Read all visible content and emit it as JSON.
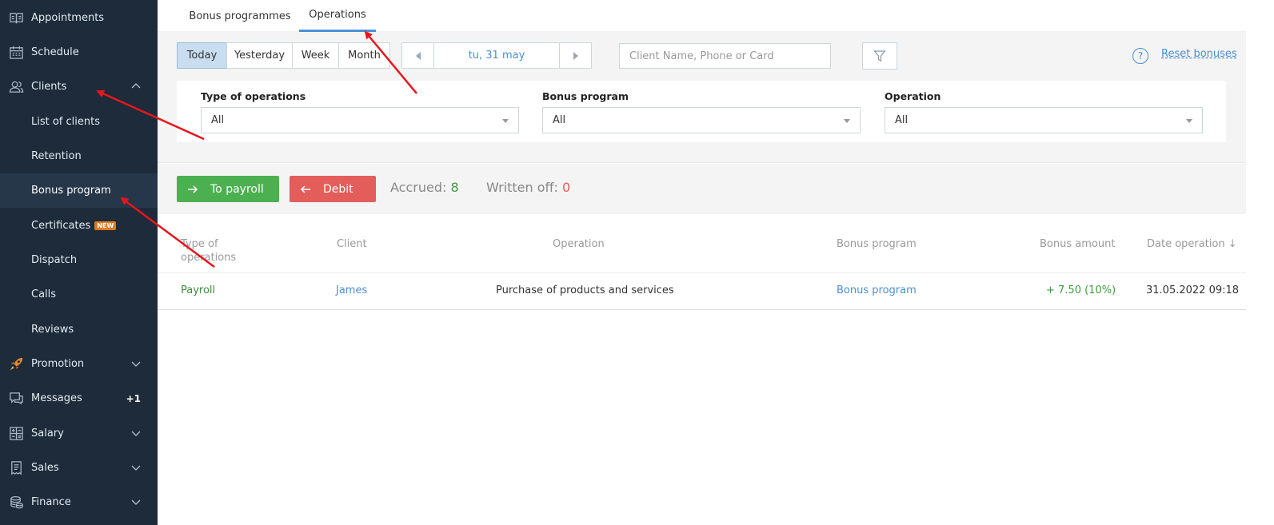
{
  "sidebar": {
    "items": [
      {
        "label": "Appointments",
        "icon": "book-icon"
      },
      {
        "label": "Schedule",
        "icon": "calendar-icon"
      },
      {
        "label": "Clients",
        "icon": "users-icon"
      },
      {
        "label": "List of clients"
      },
      {
        "label": "Retention"
      },
      {
        "label": "Bonus program"
      },
      {
        "label": "Certificates",
        "badge": "NEW"
      },
      {
        "label": "Dispatch"
      },
      {
        "label": "Calls"
      },
      {
        "label": "Reviews"
      },
      {
        "label": "Promotion",
        "icon": "rocket-icon"
      },
      {
        "label": "Messages",
        "icon": "messages-icon",
        "count": "+1"
      },
      {
        "label": "Salary",
        "icon": "calculator-icon"
      },
      {
        "label": "Sales",
        "icon": "receipt-icon"
      },
      {
        "label": "Finance",
        "icon": "coins-icon"
      }
    ]
  },
  "tabs": [
    "Bonus programmes",
    "Operations"
  ],
  "period": [
    "Today",
    "Yesterday",
    "Week",
    "Month"
  ],
  "date_label": "tu, 31 may",
  "search": {
    "placeholder": "Client Name, Phone or Card"
  },
  "help_glyph": "?",
  "reset_bonuses": "Reset bonuses",
  "filters": [
    {
      "label": "Type of operations",
      "value": "All"
    },
    {
      "label": "Bonus program",
      "value": "All"
    },
    {
      "label": "Operation",
      "value": "All"
    }
  ],
  "actions": {
    "to_payroll": "To payroll",
    "debit": "Debit"
  },
  "stats": {
    "accrued_label": "Accrued: ",
    "accrued": "8",
    "written_label": "Written off: ",
    "written": "0"
  },
  "table": {
    "headers": [
      "Type of operations",
      "Client",
      "Operation",
      "Bonus program",
      "Bonus amount",
      "Date operation ↓"
    ],
    "rows": [
      {
        "type": "Payroll",
        "client": "James",
        "operation": "Purchase of products and services",
        "program": "Bonus program",
        "amount": "+ 7.50 (10%)",
        "date": "31.05.2022 09:18"
      }
    ]
  },
  "colors": {
    "sidebar_bg": "#1d2b3a",
    "accent_blue": "#4a8fd4",
    "green": "#4cb050",
    "red": "#e35d5b",
    "annotation_arrow": "#e8161b"
  }
}
